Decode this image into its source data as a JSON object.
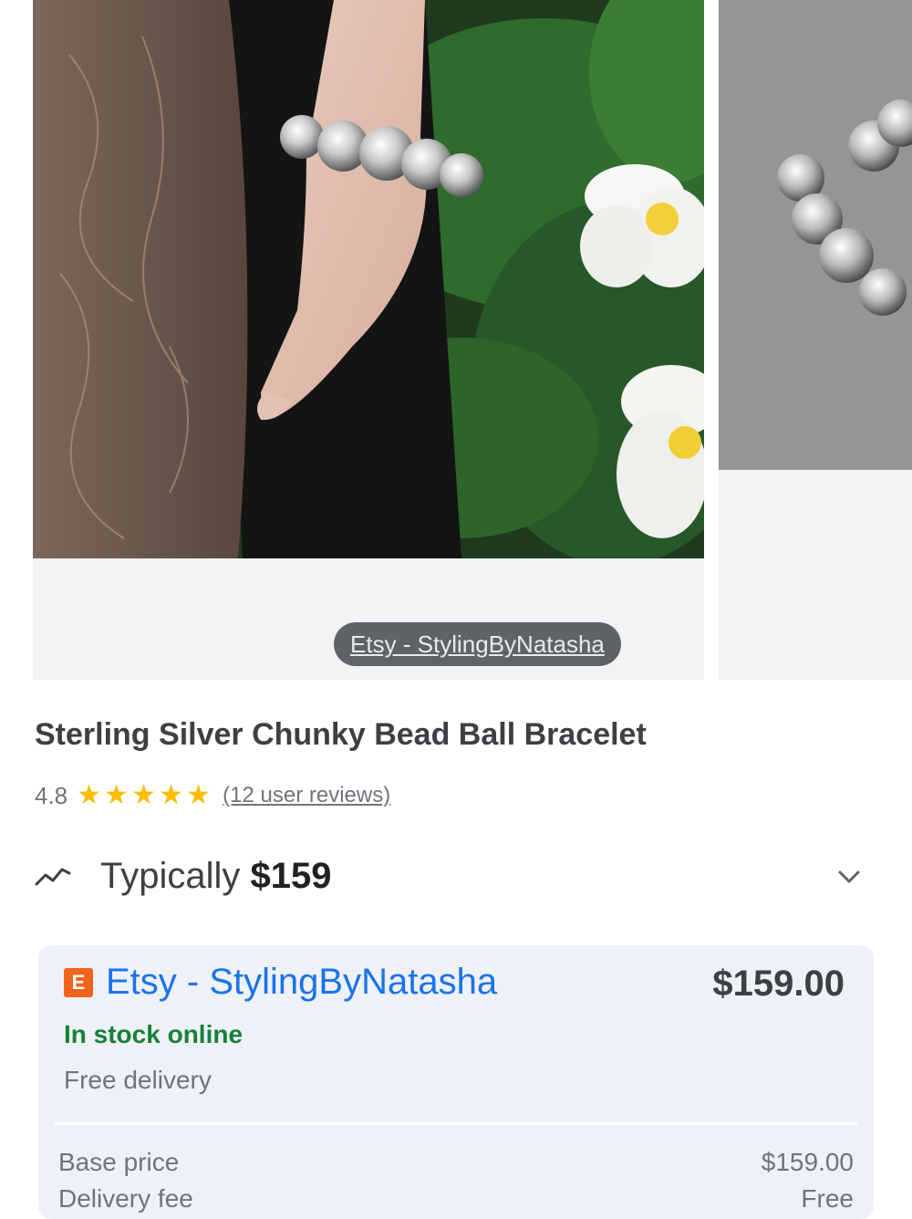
{
  "gallery": {
    "source_chip": "Etsy - StylingByNatasha"
  },
  "product": {
    "title": "Sterling Silver Chunky Bead Ball Bracelet",
    "rating": "4.8",
    "star_count": 5,
    "reviews_link": "(12 user reviews)"
  },
  "pricing": {
    "typical_label": "Typically",
    "typical_price": "$159",
    "trend_icon": "price-trend-icon",
    "expand_icon": "chevron-down-icon"
  },
  "offer": {
    "merchant_icon": "etsy-logo-icon",
    "merchant_badge": "E",
    "merchant": "Etsy - StylingByNatasha",
    "price": "$159.00",
    "stock": "In stock online",
    "delivery": "Free delivery",
    "breakdown": [
      {
        "label": "Base price",
        "value": "$159.00"
      },
      {
        "label": "Delivery fee",
        "value": "Free"
      }
    ]
  },
  "colors": {
    "link_blue": "#1a73e8",
    "stock_green": "#188038",
    "star_yellow": "#fbbc04",
    "etsy_orange": "#f1641e"
  }
}
